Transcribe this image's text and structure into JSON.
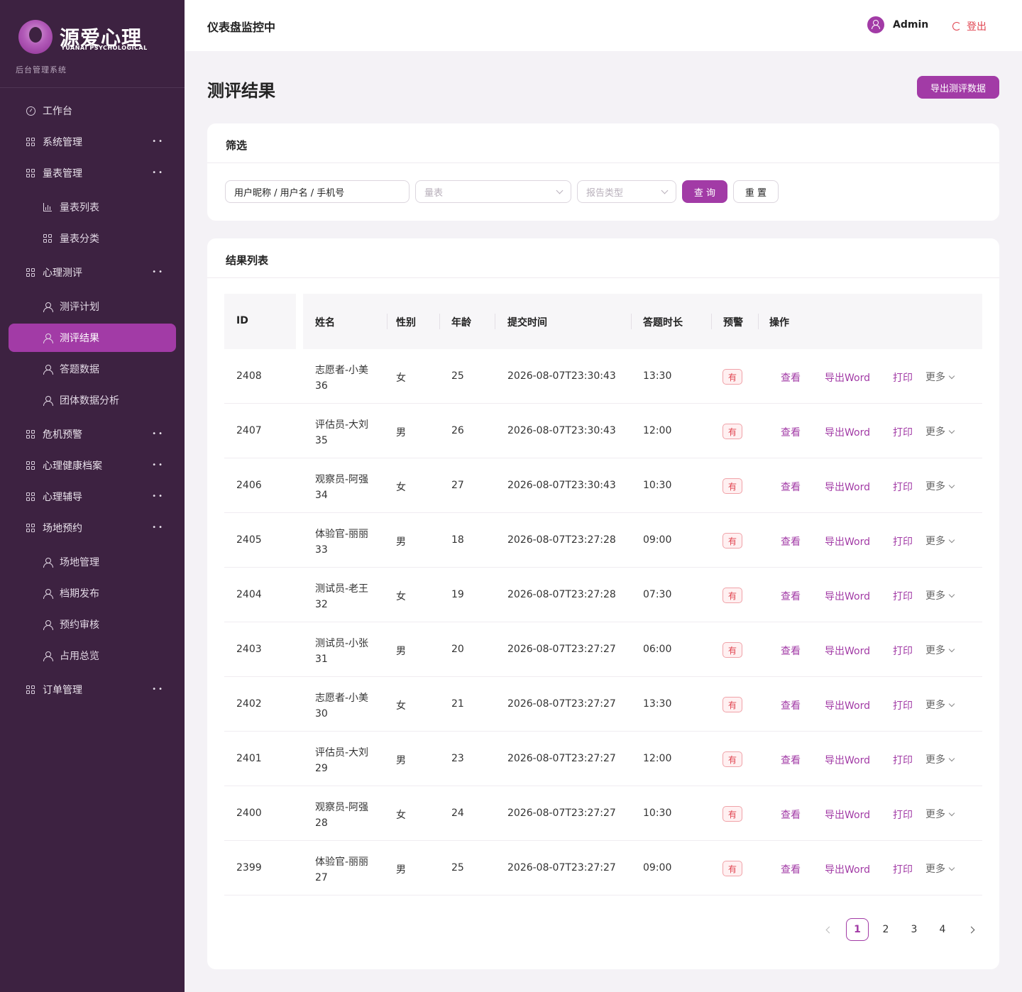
{
  "brand": {
    "name": "源爱心理",
    "en": "YUANAI PSYCHOLOGICAL",
    "subtitle": "后台管理系统"
  },
  "sidebar": {
    "items": [
      {
        "label": "工作台",
        "icon": "dashboard-icon",
        "level": 1
      },
      {
        "label": "系统管理",
        "icon": "grid-icon",
        "level": 1,
        "expander": "••"
      },
      {
        "label": "量表管理",
        "icon": "grid-icon",
        "level": 1,
        "expander": "••"
      },
      {
        "label": "量表列表",
        "icon": "bar-chart-icon",
        "level": 2
      },
      {
        "label": "量表分类",
        "icon": "grid-icon",
        "level": 2
      },
      {
        "label": "心理测评",
        "icon": "grid-icon",
        "level": 1,
        "expander": "••"
      },
      {
        "label": "测评计划",
        "icon": "user-icon",
        "level": 2
      },
      {
        "label": "测评结果",
        "icon": "user-icon",
        "level": 2,
        "active": true
      },
      {
        "label": "答题数据",
        "icon": "user-icon",
        "level": 2
      },
      {
        "label": "团体数据分析",
        "icon": "user-icon",
        "level": 2
      },
      {
        "label": "危机预警",
        "icon": "grid-icon",
        "level": 1,
        "expander": "••"
      },
      {
        "label": "心理健康档案",
        "icon": "grid-icon",
        "level": 1,
        "expander": "••"
      },
      {
        "label": "心理辅导",
        "icon": "grid-icon",
        "level": 1,
        "expander": "••"
      },
      {
        "label": "场地预约",
        "icon": "grid-icon",
        "level": 1,
        "expander": "••"
      },
      {
        "label": "场地管理",
        "icon": "user-icon",
        "level": 2
      },
      {
        "label": "档期发布",
        "icon": "user-icon",
        "level": 2
      },
      {
        "label": "预约审核",
        "icon": "user-icon",
        "level": 2
      },
      {
        "label": "占用总览",
        "icon": "user-icon",
        "level": 2
      },
      {
        "label": "订单管理",
        "icon": "grid-icon",
        "level": 1,
        "expander": "••"
      }
    ]
  },
  "topbar": {
    "title": "仪表盘监控中",
    "user": "Admin",
    "logout": "登出"
  },
  "page": {
    "title": "测评结果",
    "export_label": "导出测评数据"
  },
  "filter": {
    "title": "筛选",
    "keyword_value": "用户昵称 / 用户名 / 手机号",
    "scale_placeholder": "量表",
    "report_placeholder": "报告类型",
    "query_label": "查 询",
    "reset_label": "重 置"
  },
  "results": {
    "title": "结果列表",
    "columns": [
      "ID",
      "姓名",
      "性别",
      "年龄",
      "提交时间",
      "答题时长",
      "预警",
      "操作"
    ],
    "rows": [
      {
        "id": "2408",
        "name": "志愿者-小美",
        "name2": "36",
        "gender": "女",
        "age": "25",
        "time": "2026-08-07T23:30:43",
        "duration": "13:30",
        "warn": "有"
      },
      {
        "id": "2407",
        "name": "评估员-大刘",
        "name2": "35",
        "gender": "男",
        "age": "26",
        "time": "2026-08-07T23:30:43",
        "duration": "12:00",
        "warn": "有"
      },
      {
        "id": "2406",
        "name": "观察员-阿强",
        "name2": "34",
        "gender": "女",
        "age": "27",
        "time": "2026-08-07T23:30:43",
        "duration": "10:30",
        "warn": "有"
      },
      {
        "id": "2405",
        "name": "体验官-丽丽",
        "name2": "33",
        "gender": "男",
        "age": "18",
        "time": "2026-08-07T23:27:28",
        "duration": "09:00",
        "warn": "有"
      },
      {
        "id": "2404",
        "name": "测试员-老王",
        "name2": "32",
        "gender": "女",
        "age": "19",
        "time": "2026-08-07T23:27:28",
        "duration": "07:30",
        "warn": "有"
      },
      {
        "id": "2403",
        "name": "测试员-小张",
        "name2": "31",
        "gender": "男",
        "age": "20",
        "time": "2026-08-07T23:27:27",
        "duration": "06:00",
        "warn": "有"
      },
      {
        "id": "2402",
        "name": "志愿者-小美",
        "name2": "30",
        "gender": "女",
        "age": "21",
        "time": "2026-08-07T23:27:27",
        "duration": "13:30",
        "warn": "有"
      },
      {
        "id": "2401",
        "name": "评估员-大刘",
        "name2": "29",
        "gender": "男",
        "age": "23",
        "time": "2026-08-07T23:27:27",
        "duration": "12:00",
        "warn": "有"
      },
      {
        "id": "2400",
        "name": "观察员-阿强",
        "name2": "28",
        "gender": "女",
        "age": "24",
        "time": "2026-08-07T23:27:27",
        "duration": "10:30",
        "warn": "有"
      },
      {
        "id": "2399",
        "name": "体验官-丽丽",
        "name2": "27",
        "gender": "男",
        "age": "25",
        "time": "2026-08-07T23:27:27",
        "duration": "09:00",
        "warn": "有"
      }
    ],
    "actions": {
      "view": "查看",
      "export_word": "导出Word",
      "print": "打印",
      "more": "更多"
    }
  },
  "pagination": {
    "pages": [
      "1",
      "2",
      "3",
      "4"
    ],
    "current": "1"
  },
  "colors": {
    "sidebar": "#3d2241",
    "accent": "#a23ba6",
    "danger": "#e0434f"
  }
}
